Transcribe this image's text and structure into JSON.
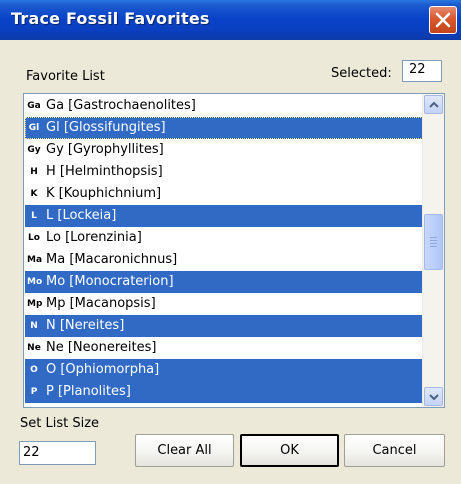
{
  "window": {
    "title": "Trace Fossil Favorites"
  },
  "favorite_list_label": "Favorite List",
  "selected_label": "Selected:",
  "selected_count": "22",
  "items": [
    {
      "code": "Ga",
      "label": "Ga [Gastrochaenolites]",
      "selected": false
    },
    {
      "code": "Gl",
      "label": "Gl [Glossifungites]",
      "selected": true
    },
    {
      "code": "Gy",
      "label": "Gy [Gyrophyllites]",
      "selected": false
    },
    {
      "code": "H",
      "label": "H [Helminthopsis]",
      "selected": false
    },
    {
      "code": "K",
      "label": "K [Kouphichnium]",
      "selected": false
    },
    {
      "code": "L",
      "label": "L [Lockeia]",
      "selected": true
    },
    {
      "code": "Lo",
      "label": "Lo [Lorenzinia]",
      "selected": false
    },
    {
      "code": "Ma",
      "label": "Ma [Macaronichnus]",
      "selected": false
    },
    {
      "code": "Mo",
      "label": "Mo [Monocraterion]",
      "selected": true
    },
    {
      "code": "Mp",
      "label": "Mp [Macanopsis]",
      "selected": false
    },
    {
      "code": "N",
      "label": "N [Nereites]",
      "selected": true
    },
    {
      "code": "Ne",
      "label": "Ne [Neonereites]",
      "selected": false
    },
    {
      "code": "O",
      "label": "O [Ophiomorpha]",
      "selected": true
    },
    {
      "code": "P",
      "label": "P [Planolites]",
      "selected": true
    }
  ],
  "set_list_size_label": "Set List Size",
  "list_size_value": "22",
  "buttons": {
    "clear_all": "Clear All",
    "ok": "OK",
    "cancel": "Cancel"
  }
}
